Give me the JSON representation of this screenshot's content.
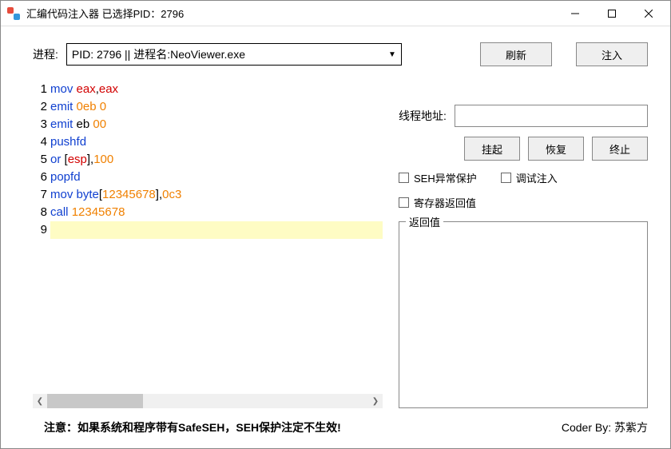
{
  "window": {
    "title": "汇编代码注入器    已选择PID：2796"
  },
  "process": {
    "label": "进程:",
    "selected": "PID: 2796    || 进程名:NeoViewer.exe",
    "refresh": "刷新",
    "inject": "注入"
  },
  "code": {
    "lines": [
      [
        {
          "t": "mov ",
          "c": "blue"
        },
        {
          "t": "eax",
          "c": "red"
        },
        {
          "t": ",",
          "c": "black"
        },
        {
          "t": "eax",
          "c": "red"
        }
      ],
      [
        {
          "t": "emit ",
          "c": "blue"
        },
        {
          "t": "0eb 0",
          "c": "orange"
        }
      ],
      [
        {
          "t": "emit ",
          "c": "blue"
        },
        {
          "t": "eb ",
          "c": "black"
        },
        {
          "t": "00",
          "c": "orange"
        }
      ],
      [
        {
          "t": "pushfd",
          "c": "blue"
        }
      ],
      [
        {
          "t": "or ",
          "c": "blue"
        },
        {
          "t": "[",
          "c": "black"
        },
        {
          "t": "esp",
          "c": "red"
        },
        {
          "t": "]",
          "c": "black"
        },
        {
          "t": ",",
          "c": "black"
        },
        {
          "t": "100",
          "c": "orange"
        }
      ],
      [
        {
          "t": "popfd",
          "c": "blue"
        }
      ],
      [
        {
          "t": "mov byte",
          "c": "blue"
        },
        {
          "t": "[",
          "c": "black"
        },
        {
          "t": "12345678",
          "c": "orange"
        },
        {
          "t": "]",
          "c": "black"
        },
        {
          "t": ",",
          "c": "black"
        },
        {
          "t": "0c3",
          "c": "orange"
        }
      ],
      [
        {
          "t": "call ",
          "c": "blue"
        },
        {
          "t": "12345678",
          "c": "orange"
        }
      ],
      []
    ]
  },
  "thread": {
    "label": "线程地址:",
    "value": "",
    "suspend": "挂起",
    "resume": "恢复",
    "terminate": "终止"
  },
  "options": {
    "seh": "SEH异常保护",
    "debuginject": "调试注入",
    "regreturn": "寄存器返回值",
    "retgroup": "返回值"
  },
  "footer": {
    "note": "注意：如果系统和程序带有SafeSEH，SEH保护注定不生效!",
    "credit_label": "Coder By:  ",
    "credit_name": "苏紫方"
  }
}
